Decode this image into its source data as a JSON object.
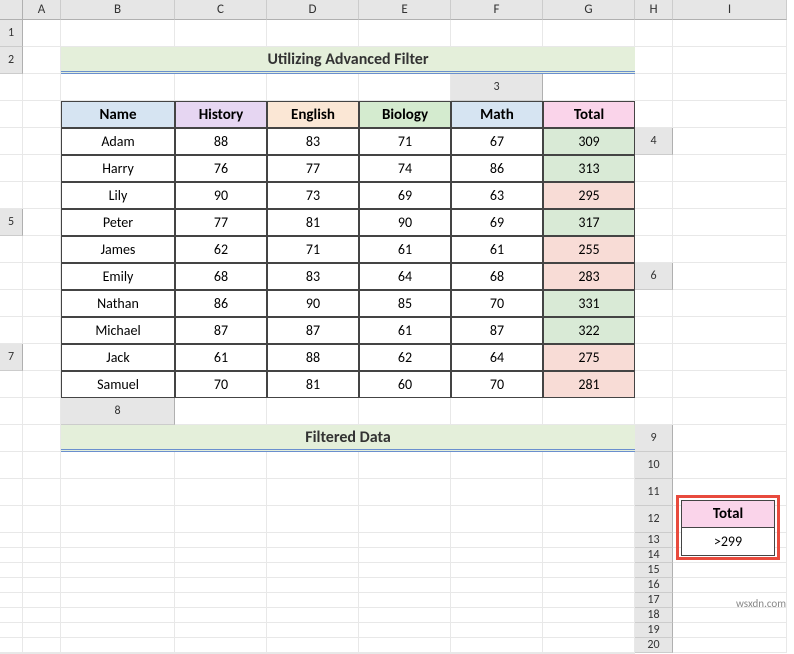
{
  "columns": [
    "",
    "A",
    "B",
    "C",
    "D",
    "E",
    "F",
    "G",
    "H",
    "I"
  ],
  "rows": [
    "1",
    "2",
    "3",
    "4",
    "5",
    "6",
    "7",
    "8",
    "9",
    "10",
    "11",
    "12",
    "13",
    "14",
    "15",
    "16",
    "17",
    "18",
    "19",
    "20"
  ],
  "title1": "Utilizing Advanced Filter",
  "title2": "Filtered Data",
  "headers": [
    "Name",
    "History",
    "English",
    "Biology",
    "Math",
    "Total"
  ],
  "table": [
    {
      "name": "Adam",
      "history": "88",
      "english": "83",
      "biology": "71",
      "math": "67",
      "total": "309",
      "hot": false
    },
    {
      "name": "Harry",
      "history": "76",
      "english": "77",
      "biology": "74",
      "math": "86",
      "total": "313",
      "hot": false
    },
    {
      "name": "Lily",
      "history": "90",
      "english": "73",
      "biology": "69",
      "math": "63",
      "total": "295",
      "hot": true
    },
    {
      "name": "Peter",
      "history": "77",
      "english": "81",
      "biology": "90",
      "math": "69",
      "total": "317",
      "hot": false
    },
    {
      "name": "James",
      "history": "62",
      "english": "71",
      "biology": "61",
      "math": "61",
      "total": "255",
      "hot": true
    },
    {
      "name": "Emily",
      "history": "68",
      "english": "83",
      "biology": "64",
      "math": "68",
      "total": "283",
      "hot": true
    },
    {
      "name": "Nathan",
      "history": "86",
      "english": "90",
      "biology": "85",
      "math": "70",
      "total": "331",
      "hot": false
    },
    {
      "name": "Michael",
      "history": "87",
      "english": "87",
      "biology": "61",
      "math": "87",
      "total": "322",
      "hot": false
    },
    {
      "name": "Jack",
      "history": "61",
      "english": "88",
      "biology": "62",
      "math": "64",
      "total": "275",
      "hot": true
    },
    {
      "name": "Samuel",
      "history": "70",
      "english": "81",
      "biology": "60",
      "math": "70",
      "total": "281",
      "hot": true
    }
  ],
  "criteria": {
    "label": "Total",
    "value": ">299"
  },
  "watermark": "wsxdn.com"
}
